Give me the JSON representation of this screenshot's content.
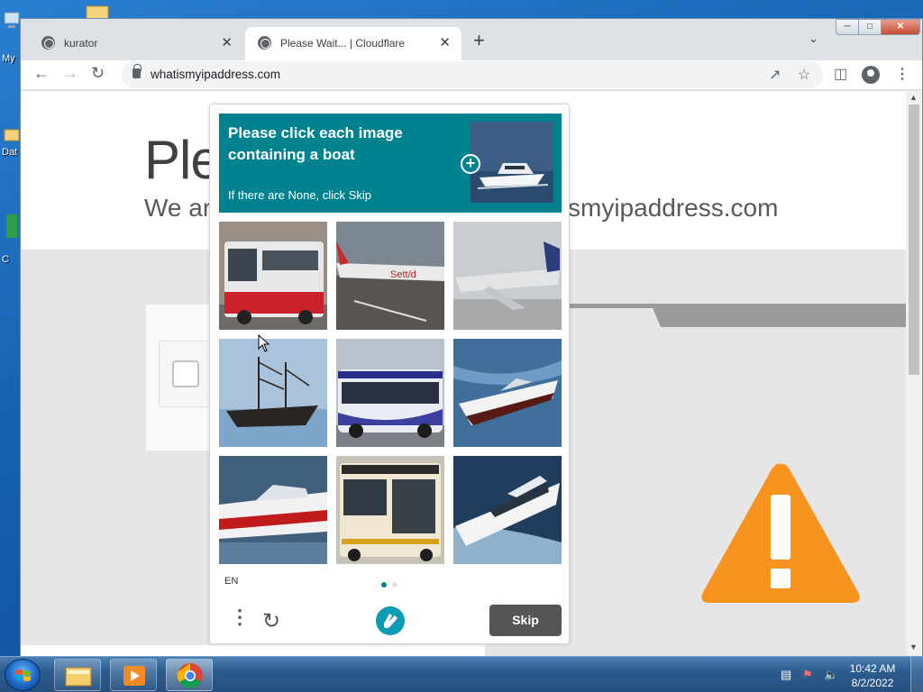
{
  "desktop": {
    "icon_labels": [
      "My",
      "Dat",
      "C"
    ]
  },
  "browser": {
    "tabs": [
      {
        "title": "kurator",
        "active": false
      },
      {
        "title": "Please Wait... | Cloudflare",
        "active": true
      }
    ],
    "new_tab": "+",
    "address": "whatismyipaddress.com"
  },
  "page": {
    "heading": "Ple",
    "subheading_left": "We ar",
    "subheading_right": "smyipaddress.com"
  },
  "captcha": {
    "prompt": "Please click each image containing a boat",
    "hint": "If there are None, click Skip",
    "images": [
      "bus",
      "airplane",
      "airplane",
      "sailboat",
      "bus",
      "motorboat",
      "motorboat",
      "bus",
      "yacht"
    ],
    "language": "EN",
    "skip_label": "Skip",
    "page_count": 2,
    "current_page": 1
  },
  "taskbar": {
    "time": "10:42 AM",
    "date": "8/2/2022"
  },
  "colors": {
    "captcha_teal": "#00838f",
    "warning_orange": "#f7931e"
  }
}
